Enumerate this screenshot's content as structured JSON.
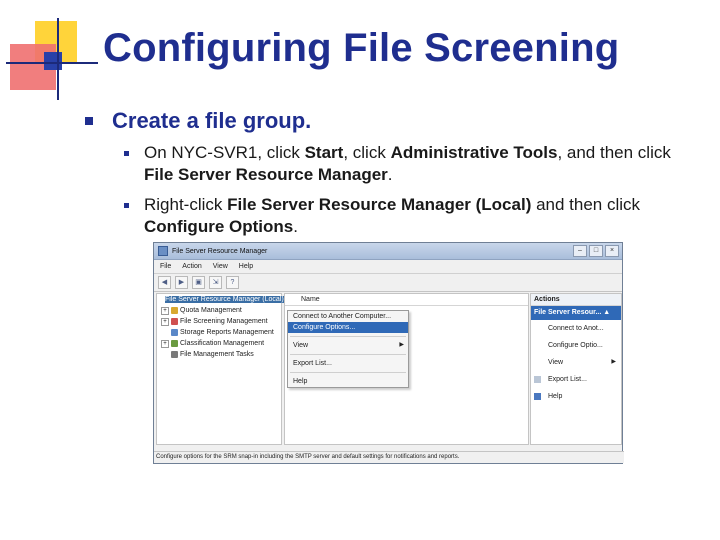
{
  "slide": {
    "title": "Configuring File Screening",
    "bullet_main": "Create a file group.",
    "sub1": {
      "p1": "On NYC-SVR1, click ",
      "b1": "Start",
      "p2": ", click ",
      "b2": "Administrative Tools",
      "p3": ", and then click ",
      "b3": "File Server Resource Manager",
      "p4": "."
    },
    "sub2": {
      "p1": "Right-click ",
      "b1": "File Server Resource Manager (Local)",
      "p2": " and then click ",
      "b2": "Configure Options",
      "p3": "."
    }
  },
  "window": {
    "title": "File Server Resource Manager",
    "buttons": [
      "–",
      "□",
      "×"
    ],
    "menu": [
      "File",
      "Action",
      "View",
      "Help"
    ],
    "toolbar_icons": [
      "back-icon",
      "forward-icon",
      "console-icon",
      "export-icon",
      "help-icon"
    ],
    "tree": [
      {
        "label": "File Server Resource Manager (Local)",
        "selected": true,
        "expander": "",
        "color": "#4a78b8"
      },
      {
        "label": "Quota Management",
        "expander": "+",
        "color": "#d8a830"
      },
      {
        "label": "File Screening Management",
        "expander": "+",
        "color": "#d05050"
      },
      {
        "label": "Storage Reports Management",
        "expander": "",
        "color": "#5a88c8"
      },
      {
        "label": "Classification Management",
        "expander": "+",
        "color": "#6a9a40"
      },
      {
        "label": "File Management Tasks",
        "expander": "",
        "color": "#7a7a7a"
      }
    ],
    "column_header": "Name",
    "context_menu": {
      "items": [
        "Connect to Another Computer...",
        "Configure Options...",
        "View",
        "Export List...",
        "Help"
      ]
    },
    "actions": {
      "header": "Actions",
      "subheader": "File Server Resour...",
      "items": [
        "Connect to Anot...",
        "Configure Optio...",
        "View",
        "Export List...",
        "Help"
      ]
    },
    "status": "Configure options for the SRM snap-in including the SMTP server and default settings for notifications and reports."
  },
  "colors": {
    "title_blue": "#1f2e8f",
    "deco_yellow": "#ffd43a",
    "deco_red": "#f07070",
    "highlight_blue": "#2f69b7"
  }
}
